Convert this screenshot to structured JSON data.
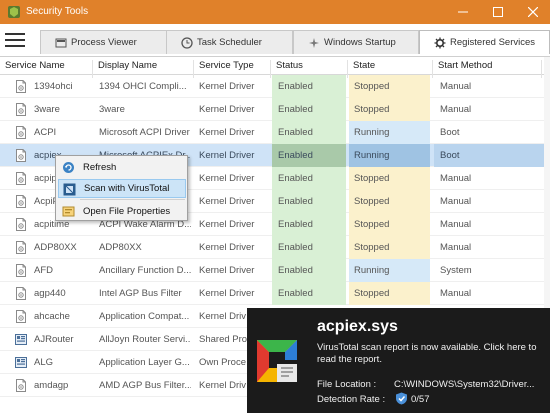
{
  "window": {
    "title": "Security Tools"
  },
  "tabs": [
    {
      "label": "Process Viewer",
      "icon": "process-icon"
    },
    {
      "label": "Task Scheduler",
      "icon": "clock-icon"
    },
    {
      "label": "Windows Startup",
      "icon": "startup-icon"
    },
    {
      "label": "Registered Services",
      "icon": "gear-icon"
    }
  ],
  "table": {
    "headers": [
      "Service Name",
      "Display Name",
      "Service Type",
      "Status",
      "State",
      "Start Method",
      "S"
    ],
    "rows": [
      {
        "name": "1394ohci",
        "display": "1394 OHCI Compli...",
        "type": "Kernel Driver",
        "status": "Enabled",
        "state": "Stopped",
        "start": "Manual"
      },
      {
        "name": "3ware",
        "display": "3ware",
        "type": "Kernel Driver",
        "status": "Enabled",
        "state": "Stopped",
        "start": "Manual"
      },
      {
        "name": "ACPI",
        "display": "Microsoft ACPI Driver",
        "type": "Kernel Driver",
        "status": "Enabled",
        "state": "Running",
        "start": "Boot"
      },
      {
        "name": "acpiex",
        "display": "Microsoft ACPIEx Dr...",
        "type": "Kernel Driver",
        "status": "Enabled",
        "state": "Running",
        "start": "Boot"
      },
      {
        "name": "acpip",
        "display": "",
        "type": "Kernel Driver",
        "status": "Enabled",
        "state": "Stopped",
        "start": "Manual"
      },
      {
        "name": "AcpiP",
        "display": "",
        "type": "Kernel Driver",
        "status": "Enabled",
        "state": "Stopped",
        "start": "Manual"
      },
      {
        "name": "acpitime",
        "display": "ACPI Wake Alarm D...",
        "type": "Kernel Driver",
        "status": "Enabled",
        "state": "Stopped",
        "start": "Manual"
      },
      {
        "name": "ADP80XX",
        "display": "ADP80XX",
        "type": "Kernel Driver",
        "status": "Enabled",
        "state": "Stopped",
        "start": "Manual"
      },
      {
        "name": "AFD",
        "display": "Ancillary Function D...",
        "type": "Kernel Driver",
        "status": "Enabled",
        "state": "Running",
        "start": "System"
      },
      {
        "name": "agp440",
        "display": "Intel AGP Bus Filter",
        "type": "Kernel Driver",
        "status": "Enabled",
        "state": "Stopped",
        "start": "Manual"
      },
      {
        "name": "ahcache",
        "display": "Application Compat...",
        "type": "Kernel Driv",
        "status": "",
        "state": "",
        "start": ""
      },
      {
        "name": "AJRouter",
        "display": "AllJoyn Router Servi...",
        "type": "Shared Pro",
        "status": "",
        "state": "",
        "start": ""
      },
      {
        "name": "ALG",
        "display": "Application Layer G...",
        "type": "Own Proce",
        "status": "",
        "state": "",
        "start": ""
      },
      {
        "name": "amdagp",
        "display": "AMD AGP Bus Filter...",
        "type": "Kernel Driv",
        "status": "",
        "state": "",
        "start": ""
      }
    ]
  },
  "context_menu": {
    "items": [
      {
        "label": "Refresh",
        "icon": "refresh-icon"
      },
      {
        "label": "Scan with VirusTotal",
        "icon": "virustotal-icon"
      },
      {
        "label": "Open File Properties",
        "icon": "properties-icon"
      }
    ]
  },
  "notification": {
    "title": "acpiex.sys",
    "message": "VirusTotal scan report is now available. Click here to read the report.",
    "location_label": "File Location :",
    "location_value": "C:\\WINDOWS\\System32\\Driver...",
    "detection_label": "Detection Rate :",
    "detection_value": "0/57"
  },
  "colors": {
    "titlebar": "#e0812a",
    "enabled": "#d9f0d5",
    "stopped": "#fbf1cc",
    "running": "#d6e9f8",
    "selected": "#cfe3f7"
  }
}
